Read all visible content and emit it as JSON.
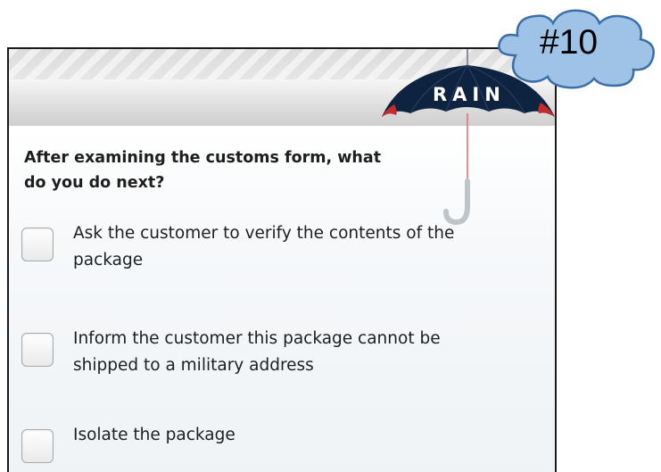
{
  "badge": {
    "label": "#10",
    "fill_color": "#9ec3e6",
    "stroke_color": "#3b6fa8",
    "icon": "cloud-icon"
  },
  "app": {
    "brand": "RAIN",
    "logo_icon": "umbrella-icon",
    "canopy_color": "#0e2340",
    "handle_color": "#d23a3a"
  },
  "quiz": {
    "question": "After examining the customs form, what do you do next?",
    "options": [
      {
        "label": "Ask the customer to verify the contents of the package",
        "checked": false
      },
      {
        "label": "Inform the customer this package cannot be shipped to a military address",
        "checked": false
      },
      {
        "label": "Isolate the package",
        "checked": false
      }
    ]
  }
}
